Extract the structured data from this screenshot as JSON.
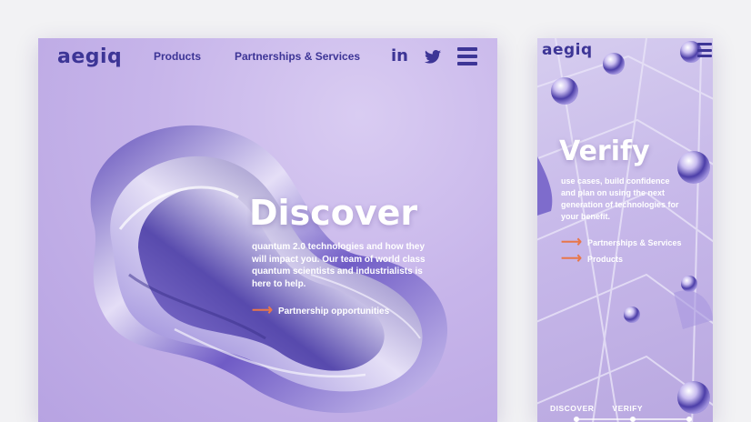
{
  "desktop": {
    "logo": "aegiq",
    "nav": {
      "products": "Products",
      "partnerships": "Partnerships & Services"
    },
    "social": {
      "linkedin": "in"
    },
    "hero": {
      "title": "Discover",
      "lines": [
        "quantum 2.0 technologies and how they",
        "will impact you. Our team of world class",
        "quantum scientists and industrialists is",
        "here to help."
      ],
      "cta": "Partnership opportunities"
    }
  },
  "mobile": {
    "logo": "aegiq",
    "hero": {
      "title": "Verify",
      "lines": [
        "use cases, build confidence",
        "and plan on using the next",
        "generation of technologies for",
        "your benefit."
      ],
      "links": [
        "Partnerships & Services",
        "Products"
      ]
    },
    "bottom_nav": [
      "DISCOVER",
      "VERIFY"
    ]
  },
  "colors": {
    "brand": "#3d3596",
    "accent": "#e8774a",
    "background": "#f2f2f4"
  },
  "icons": [
    "linkedin-icon",
    "twitter-icon",
    "hamburger-menu-icon",
    "arrow-right-icon"
  ]
}
